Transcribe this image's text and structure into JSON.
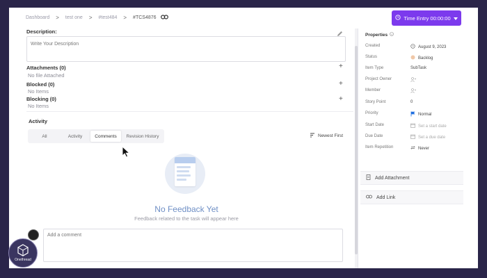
{
  "breadcrumb": [
    "Dashboard",
    "test one",
    "#test484",
    "#TCS4876"
  ],
  "time_entry_label": "Time Entry 00:00:00",
  "description": {
    "label": "Description:",
    "placeholder": "Write Your Description"
  },
  "attachments": {
    "label": "Attachments (0)",
    "empty": "No file Attached"
  },
  "blocked": {
    "label": "Blocked (0)",
    "empty": "No Items"
  },
  "blocking": {
    "label": "Blocking (0)",
    "empty": "No Items"
  },
  "activity": {
    "label": "Activity",
    "tabs": [
      "All",
      "Activity",
      "Comments",
      "Revision History"
    ],
    "active_tab": "Comments",
    "sort_label": "Newest First"
  },
  "empty_state": {
    "title": "No Feedback Yet",
    "subtitle": "Feedback related to the task will appear here"
  },
  "comment_placeholder": "Add a comment",
  "properties": {
    "header": "Properties",
    "rows": [
      {
        "key": "Created",
        "value": "August 9, 2023",
        "icon": "clock-icon"
      },
      {
        "key": "Status",
        "value": "Backlog",
        "icon": "status-dot-icon"
      },
      {
        "key": "Item Type",
        "value": "SubTask",
        "icon": ""
      },
      {
        "key": "Project Owner",
        "value": "",
        "icon": "user-add-icon"
      },
      {
        "key": "Member",
        "value": "",
        "icon": "user-add-icon"
      },
      {
        "key": "Story Point",
        "value": "0",
        "icon": ""
      },
      {
        "key": "Priority",
        "value": "Normal",
        "icon": "flag-icon"
      },
      {
        "key": "Start Date",
        "value": "Set a start date",
        "icon": "calendar-icon"
      },
      {
        "key": "Due Date",
        "value": "Set a due date",
        "icon": "calendar-icon"
      },
      {
        "key": "Item Repetition",
        "value": "Never",
        "icon": "repeat-icon"
      }
    ]
  },
  "add_attachment_label": "Add Attachment",
  "add_link_label": "Add Link",
  "logo_text": "Onethread",
  "colors": {
    "accent": "#7c3aed",
    "backdrop": "#2a2549",
    "flag": "#1f6fe0",
    "status_dot": "#f0c8a8"
  }
}
